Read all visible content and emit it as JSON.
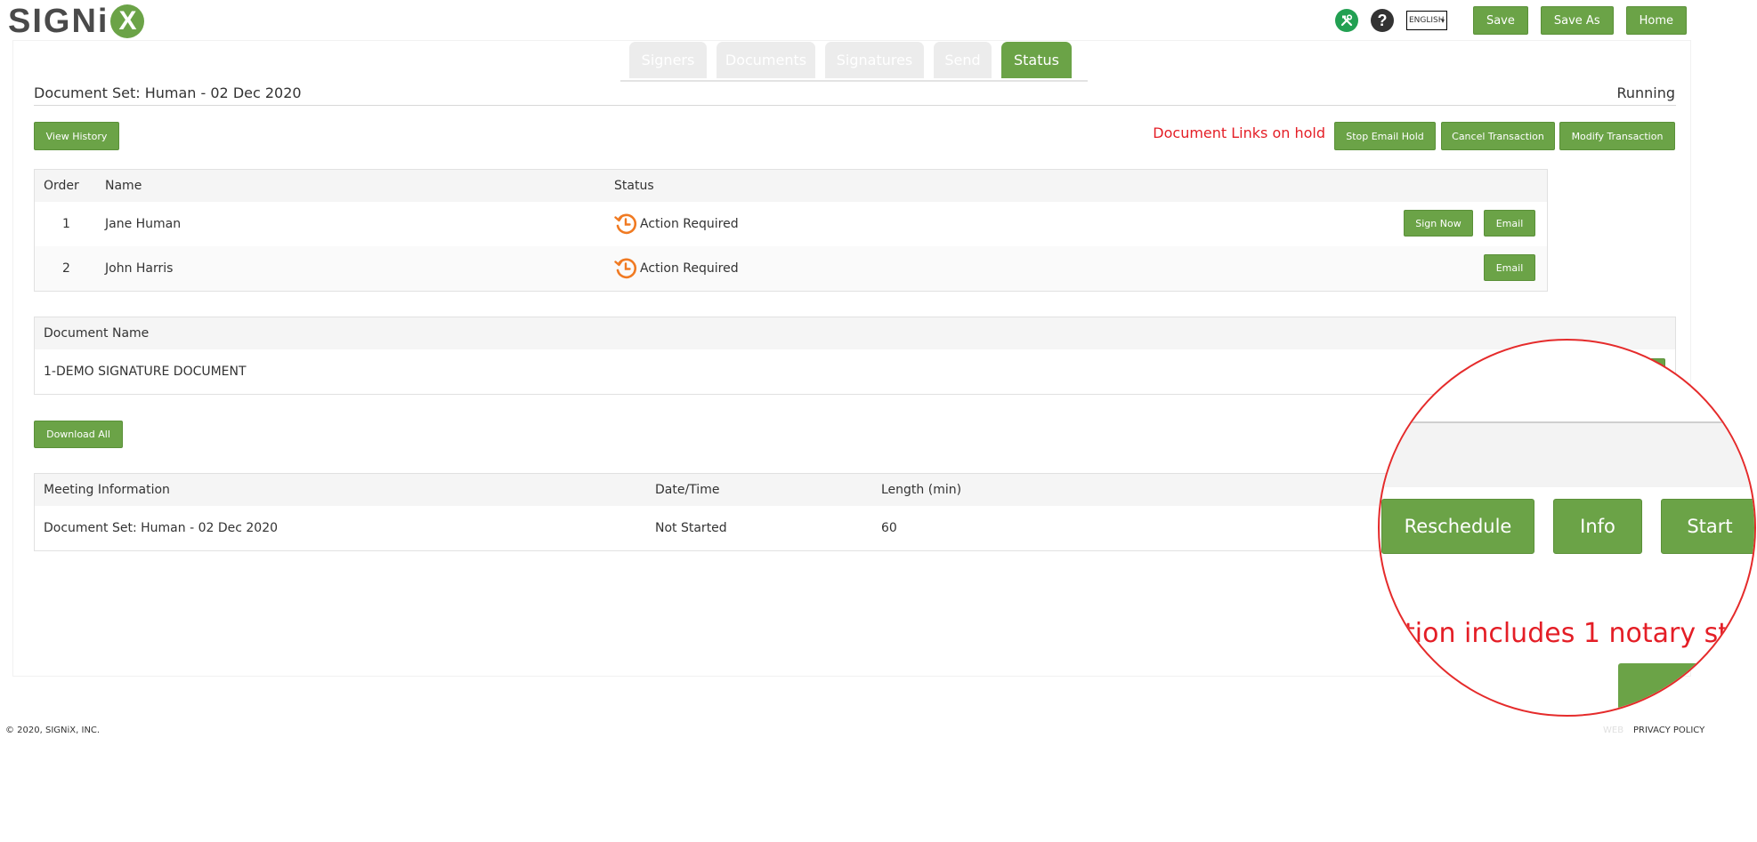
{
  "brand": {
    "logo_text": "SIGNi",
    "logo_letter": "X"
  },
  "header": {
    "language": "ENGLISH",
    "save_label": "Save",
    "save_as_label": "Save As",
    "home_label": "Home"
  },
  "tabs": [
    {
      "label": "Signers"
    },
    {
      "label": "Documents"
    },
    {
      "label": "Signatures"
    },
    {
      "label": "Send"
    },
    {
      "label": "Status"
    }
  ],
  "document_set": {
    "title": "Document Set: Human - 02 Dec 2020",
    "status": "Running"
  },
  "actions": {
    "view_history": "View History",
    "hold_message": "Document Links on hold",
    "stop_email_hold": "Stop Email Hold",
    "cancel_transaction": "Cancel Transaction",
    "modify_transaction": "Modify Transaction"
  },
  "signers_table": {
    "headers": {
      "order": "Order",
      "name": "Name",
      "status": "Status"
    },
    "rows": [
      {
        "order": "1",
        "name": "Jane Human",
        "status": "Action Required",
        "sign_now": "Sign Now",
        "email": "Email"
      },
      {
        "order": "2",
        "name": "John Harris",
        "status": "Action Required",
        "email": "Email"
      }
    ]
  },
  "documents_table": {
    "header": "Document Name",
    "rows": [
      {
        "name": "1-DEMO SIGNATURE DOCUMENT"
      }
    ]
  },
  "download_all": "Download All",
  "meeting_table": {
    "headers": {
      "info": "Meeting Information",
      "datetime": "Date/Time",
      "length": "Length (min)"
    },
    "rows": [
      {
        "info": "Document Set: Human - 02 Dec 2020",
        "datetime": "Not Started",
        "length": "60"
      }
    ]
  },
  "magnifier": {
    "reschedule": "Reschedule",
    "info": "Info",
    "start": "Start",
    "message": "tion includes 1 notary st"
  },
  "footer": {
    "copyright": "© 2020, SIGNiX, INC.",
    "version": "WEB",
    "privacy": "PRIVACY POLICY"
  },
  "colors": {
    "accent": "#6ba347",
    "alert": "#e41e26",
    "status_icon": "#f07a22"
  }
}
